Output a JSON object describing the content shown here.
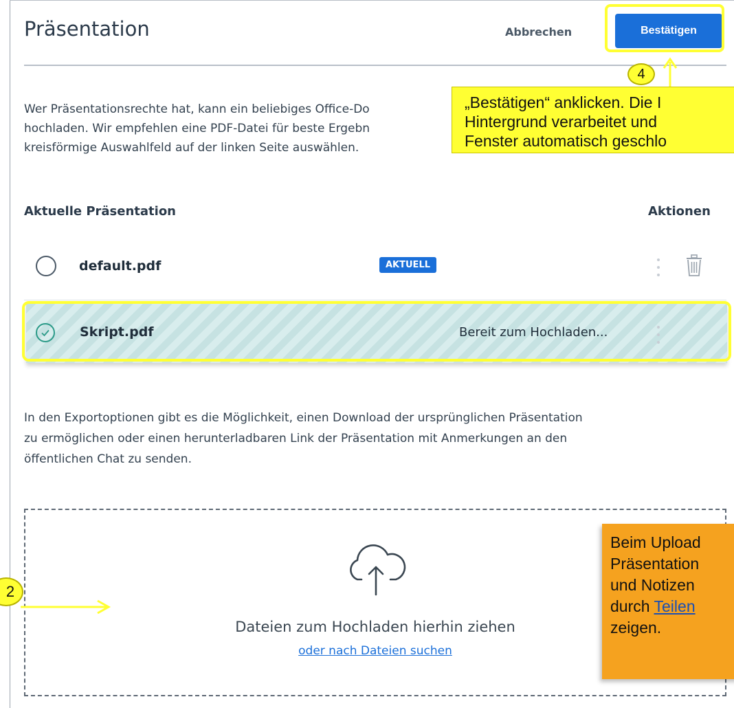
{
  "header": {
    "title": "Präsentation",
    "cancel_label": "Abbrechen",
    "confirm_label": "Bestätigen"
  },
  "intro": {
    "lines": [
      "Wer Präsentationsrechte hat, kann ein beliebiges Office-Do",
      "hochladen. Wir empfehlen eine PDF-Datei für beste Ergebn",
      "kreisförmige Auswahlfeld auf der linken Seite auswählen."
    ]
  },
  "table": {
    "col_current": "Aktuelle Präsentation",
    "col_actions": "Aktionen",
    "rows": [
      {
        "name": "default.pdf",
        "badge": "AKTUELL",
        "status": ""
      },
      {
        "name": "Skript.pdf",
        "badge": "",
        "status": "Bereit zum Hochladen..."
      }
    ]
  },
  "export_note": {
    "lines": [
      "In den Exportoptionen gibt es die Möglichkeit, einen Download der ursprünglichen Präsentation",
      "zu ermöglichen oder einen herunterladbaren Link der Präsentation mit Anmerkungen an den",
      "öffentlichen Chat zu senden."
    ]
  },
  "dropzone": {
    "text": "Dateien zum Hochladen hierhin ziehen",
    "link": "oder nach Dateien suchen"
  },
  "annotations": {
    "callout_confirm": {
      "lines": [
        "„Bestätigen“ anklicken. Die I",
        "Hintergrund verarbeitet und",
        "Fenster automatisch geschlo"
      ]
    },
    "callout_upload": {
      "lines": [
        "Beim Upload",
        "Präsentation",
        "und Notizen",
        "durch "
      ],
      "link": "Teilen",
      "last_line": "zeigen."
    },
    "step_confirm": "4",
    "step_drop": "2"
  },
  "colors": {
    "accent": "#1a6fd9",
    "highlight": "#ffff33",
    "callout_orange": "#f5a21f",
    "selected_row": "#c6e2e2"
  }
}
